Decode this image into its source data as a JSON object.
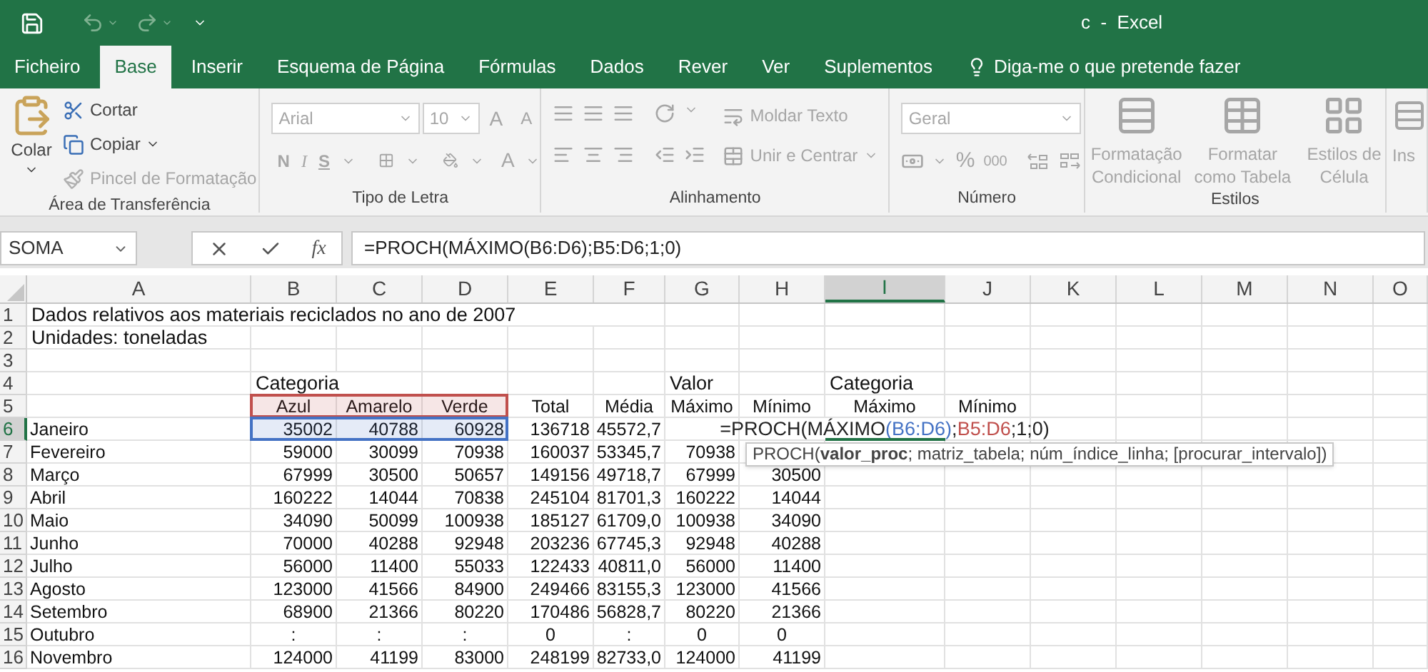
{
  "window": {
    "title": "c  -  Excel"
  },
  "tabs": [
    {
      "label": "Ficheiro",
      "selected": false
    },
    {
      "label": "Base",
      "selected": true
    },
    {
      "label": "Inserir",
      "selected": false
    },
    {
      "label": "Esquema de Página",
      "selected": false
    },
    {
      "label": "Fórmulas",
      "selected": false
    },
    {
      "label": "Dados",
      "selected": false
    },
    {
      "label": "Rever",
      "selected": false
    },
    {
      "label": "Ver",
      "selected": false
    },
    {
      "label": "Suplementos",
      "selected": false
    }
  ],
  "tell_me": {
    "placeholder": "Diga-me o que pretende fazer"
  },
  "ribbon": {
    "groups": [
      {
        "kind": "clipboard",
        "label": "Área de Transferência",
        "paste": "Colar",
        "items": [
          {
            "label": "Cortar",
            "disabled": false
          },
          {
            "label": "Copiar",
            "disabled": false
          },
          {
            "label": "Pincel de Formatação",
            "disabled": true
          }
        ]
      },
      {
        "kind": "font",
        "label": "Tipo de Letra",
        "font_name": "Arial",
        "font_size": "10",
        "letters": [
          "A",
          "A"
        ],
        "styles": [
          "N",
          "I",
          "S"
        ],
        "font_color": "A"
      },
      {
        "kind": "alignment",
        "label": "Alinhamento",
        "commands": [
          "Moldar Texto",
          "Unir e Centrar"
        ]
      },
      {
        "kind": "number",
        "label": "Número",
        "format": "Geral",
        "symbols": [
          "%",
          "000"
        ]
      },
      {
        "kind": "styles",
        "label": "Estilos",
        "commands": [
          "Formatação Condicional",
          "Formatar como Tabela",
          "Estilos de Célula"
        ]
      },
      {
        "kind": "cells",
        "commands": [
          "Ins"
        ]
      }
    ]
  },
  "formula_bar": {
    "name_box": "SOMA",
    "fx": "fx",
    "formula": "=PROCH(MÁXIMO(B6:D6);B5:D6;1;0)"
  },
  "sheet": {
    "columns": [
      {
        "label": "A",
        "selected": false
      },
      {
        "label": "B",
        "selected": false
      },
      {
        "label": "C",
        "selected": false
      },
      {
        "label": "D",
        "selected": false
      },
      {
        "label": "E",
        "selected": false
      },
      {
        "label": "F",
        "selected": false
      },
      {
        "label": "G",
        "selected": false
      },
      {
        "label": "H",
        "selected": false
      },
      {
        "label": "I",
        "selected": true
      },
      {
        "label": "J",
        "selected": false
      },
      {
        "label": "K",
        "selected": false
      },
      {
        "label": "L",
        "selected": false
      },
      {
        "label": "M",
        "selected": false
      },
      {
        "label": "N",
        "selected": false
      },
      {
        "label": "O",
        "selected": false
      }
    ],
    "rows": [
      {
        "number": "1",
        "selected": false,
        "kind": "text",
        "cells": {
          "A": "Dados relativos aos materiais reciclados no ano de 2007"
        }
      },
      {
        "number": "2",
        "selected": false,
        "kind": "text",
        "cells": {
          "A": "Unidades: toneladas"
        }
      },
      {
        "number": "3",
        "selected": false,
        "kind": "text"
      },
      {
        "number": "4",
        "selected": false,
        "kind": "text",
        "cells": {
          "B": "Categoria",
          "G": "Valor",
          "I": "Categoria"
        }
      },
      {
        "number": "5",
        "selected": false,
        "kind": "header",
        "cells": {
          "B": {
            "text": "Azul",
            "color": "#c0504d"
          },
          "C": {
            "text": "Amarelo",
            "color": "#c0504d"
          },
          "D": {
            "text": "Verde",
            "color": "#c0504d"
          },
          "E": "Total",
          "F": "Média",
          "G": "Máximo",
          "H": "Mínimo",
          "I": "Máximo",
          "J": "Mínimo"
        }
      },
      {
        "number": "6",
        "selected": true,
        "kind": "number",
        "cells": {
          "A": "Janeiro",
          "B": {
            "text": "35002",
            "color": "#4472c4"
          },
          "C": {
            "text": "40788",
            "color": "#4472c4"
          },
          "D": {
            "text": "60928",
            "color": "#4472c4"
          },
          "E": "136718",
          "F": "45572,7",
          "I": {
            "active": true,
            "segments": [
              {
                "text": "=PROCH(MÁXIMO"
              },
              {
                "text": "(B6:D6)",
                "color": "#4472c4"
              },
              {
                "text": ";"
              },
              {
                "text": "B5:D6",
                "color": "#c0504d"
              },
              {
                "text": ";1;0)"
              }
            ]
          }
        }
      },
      {
        "number": "7",
        "selected": false,
        "kind": "number",
        "cells": {
          "A": "Fevereiro",
          "B": "59000",
          "C": "30099",
          "D": "70938",
          "E": "160037",
          "F": "53345,7",
          "G": "70938"
        }
      },
      {
        "number": "8",
        "selected": false,
        "kind": "number",
        "cells": {
          "A": "Março",
          "B": "67999",
          "C": "30500",
          "D": "50657",
          "E": "149156",
          "F": "49718,7",
          "G": "67999",
          "H": "30500"
        }
      },
      {
        "number": "9",
        "selected": false,
        "kind": "number",
        "cells": {
          "A": "Abril",
          "B": "160222",
          "C": "14044",
          "D": "70838",
          "E": "245104",
          "F": "81701,3",
          "G": "160222",
          "H": "14044"
        }
      },
      {
        "number": "10",
        "selected": false,
        "kind": "number",
        "cells": {
          "A": "Maio",
          "B": "34090",
          "C": "50099",
          "D": "100938",
          "E": "185127",
          "F": "61709,0",
          "G": "100938",
          "H": "34090"
        }
      },
      {
        "number": "11",
        "selected": false,
        "kind": "number",
        "cells": {
          "A": "Junho",
          "B": "70000",
          "C": "40288",
          "D": "92948",
          "E": "203236",
          "F": "67745,3",
          "G": "92948",
          "H": "40288"
        }
      },
      {
        "number": "12",
        "selected": false,
        "kind": "number",
        "cells": {
          "A": "Julho",
          "B": "56000",
          "C": "11400",
          "D": "55033",
          "E": "122433",
          "F": "40811,0",
          "G": "56000",
          "H": "11400"
        }
      },
      {
        "number": "13",
        "selected": false,
        "kind": "number",
        "cells": {
          "A": "Agosto",
          "B": "123000",
          "C": "41566",
          "D": "84900",
          "E": "249466",
          "F": "83155,3",
          "G": "123000",
          "H": "41566"
        }
      },
      {
        "number": "14",
        "selected": false,
        "kind": "number",
        "cells": {
          "A": "Setembro",
          "B": "68900",
          "C": "21366",
          "D": "80220",
          "E": "170486",
          "F": "56828,7",
          "G": "80220",
          "H": "21366"
        }
      },
      {
        "number": "15",
        "selected": false,
        "kind": "centered",
        "cells": {
          "A": "Outubro",
          "B": ":",
          "C": ":",
          "D": ":",
          "E": "0",
          "F": ":",
          "G": "0",
          "H": "0"
        }
      },
      {
        "number": "16",
        "selected": false,
        "kind": "number",
        "cells": {
          "A": "Novembro",
          "B": "124000",
          "C": "41199",
          "D": "83000",
          "E": "248199",
          "F": "82733,0",
          "G": "124000",
          "H": "41199"
        }
      }
    ],
    "tooltip": "PROCH(**valor_proc**; matriz_tabela; núm_índice_linha; [procurar_intervalo])"
  }
}
